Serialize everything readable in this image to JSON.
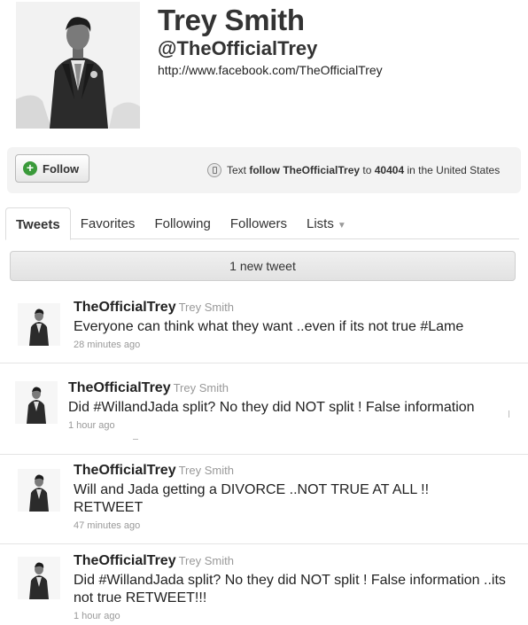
{
  "profile": {
    "name": "Trey Smith",
    "handle": "@TheOfficialTrey",
    "url": "http://www.facebook.com/TheOfficialTrey"
  },
  "follow": {
    "button_label": "Follow",
    "sms_prefix": "Text",
    "sms_command": "follow TheOfficialTrey",
    "sms_to": "to",
    "sms_number": "40404",
    "sms_suffix": "in the United States"
  },
  "tabs": [
    {
      "label": "Tweets",
      "active": true
    },
    {
      "label": "Favorites",
      "active": false
    },
    {
      "label": "Following",
      "active": false
    },
    {
      "label": "Followers",
      "active": false
    },
    {
      "label": "Lists",
      "active": false
    }
  ],
  "new_tweets_label": "1 new tweet",
  "tweets": [
    {
      "handle": "TheOfficialTrey",
      "name": "Trey Smith",
      "text": "Everyone can think what they want ..even if its not true #Lame",
      "time": "28 minutes ago"
    },
    {
      "handle": "TheOfficialTrey",
      "name": "Trey Smith",
      "text": "Did #WillandJada split? No they did NOT split ! False information",
      "time": "1 hour ago"
    },
    {
      "handle": "TheOfficialTrey",
      "name": "Trey Smith",
      "text": "Will and Jada getting a DIVORCE ..NOT TRUE AT ALL !! RETWEET",
      "time": "47 minutes ago"
    },
    {
      "handle": "TheOfficialTrey",
      "name": "Trey Smith",
      "text": "Did #WillandJada split? No they did NOT split ! False information ..its not true RETWEET!!!",
      "time": "1 hour ago"
    }
  ],
  "icons": {
    "follow": "plus-icon",
    "sms": "phone-icon",
    "lists_dropdown": "chevron-down-icon"
  },
  "colors": {
    "follow_icon": "#3a9a3a",
    "meta_text": "#999999"
  }
}
